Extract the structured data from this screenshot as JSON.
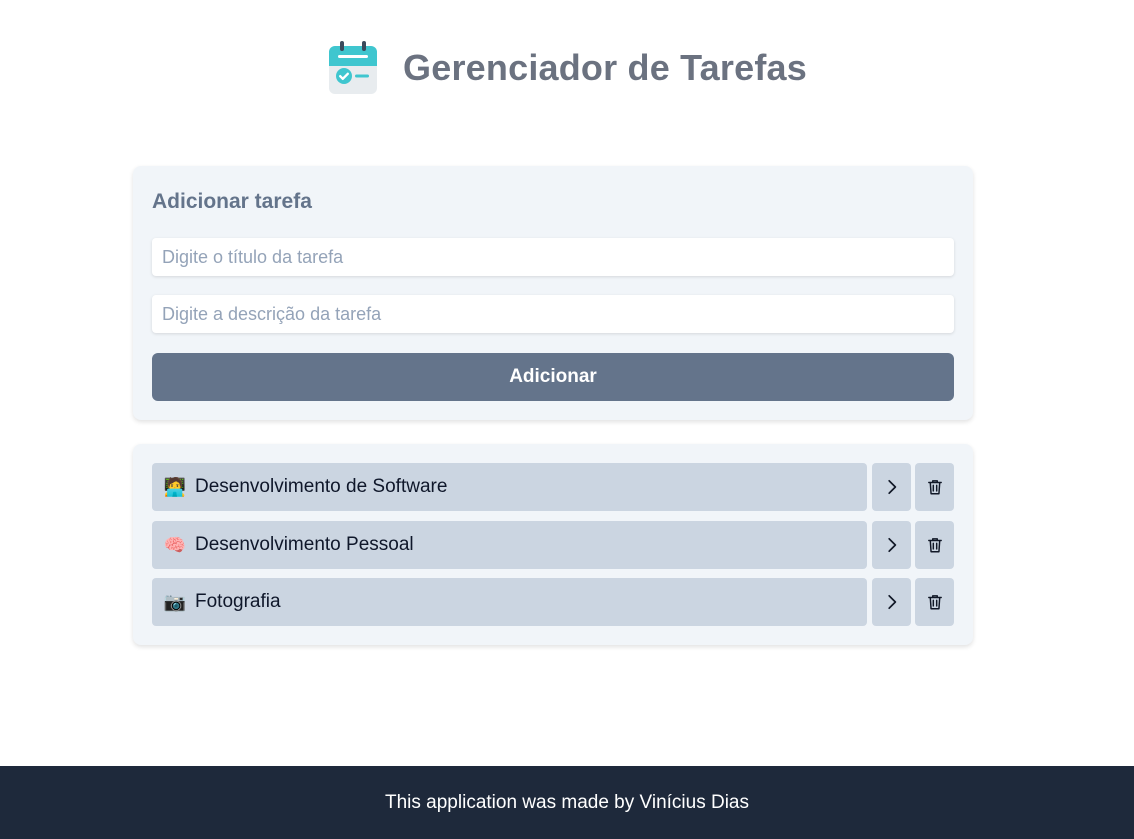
{
  "header": {
    "title": "Gerenciador de Tarefas",
    "logo_icon": "calendar-check-icon"
  },
  "add_task": {
    "heading": "Adicionar tarefa",
    "title_input": {
      "value": "",
      "placeholder": "Digite o título da tarefa"
    },
    "description_input": {
      "value": "",
      "placeholder": "Digite a descrição da tarefa"
    },
    "add_button_label": "Adicionar"
  },
  "tasks": [
    {
      "emoji": "🧑‍💻",
      "emoji_icon": "technologist-emoji-icon",
      "title": "Desenvolvimento de Software"
    },
    {
      "emoji": "🧠",
      "emoji_icon": "brain-emoji-icon",
      "title": "Desenvolvimento Pessoal"
    },
    {
      "emoji": "📷",
      "emoji_icon": "camera-emoji-icon",
      "title": "Fotografia"
    }
  ],
  "task_actions": {
    "details_icon": "chevron-right-icon",
    "delete_icon": "trash-icon"
  },
  "footer": {
    "text": "This application was made by Vinícius Dias"
  },
  "colors": {
    "title_text": "#6b7280",
    "card_background": "#f1f5f9",
    "button_background": "#64748b",
    "task_background": "#cbd5e1",
    "footer_background": "#1e293b",
    "logo_teal": "#3fc6cf"
  }
}
